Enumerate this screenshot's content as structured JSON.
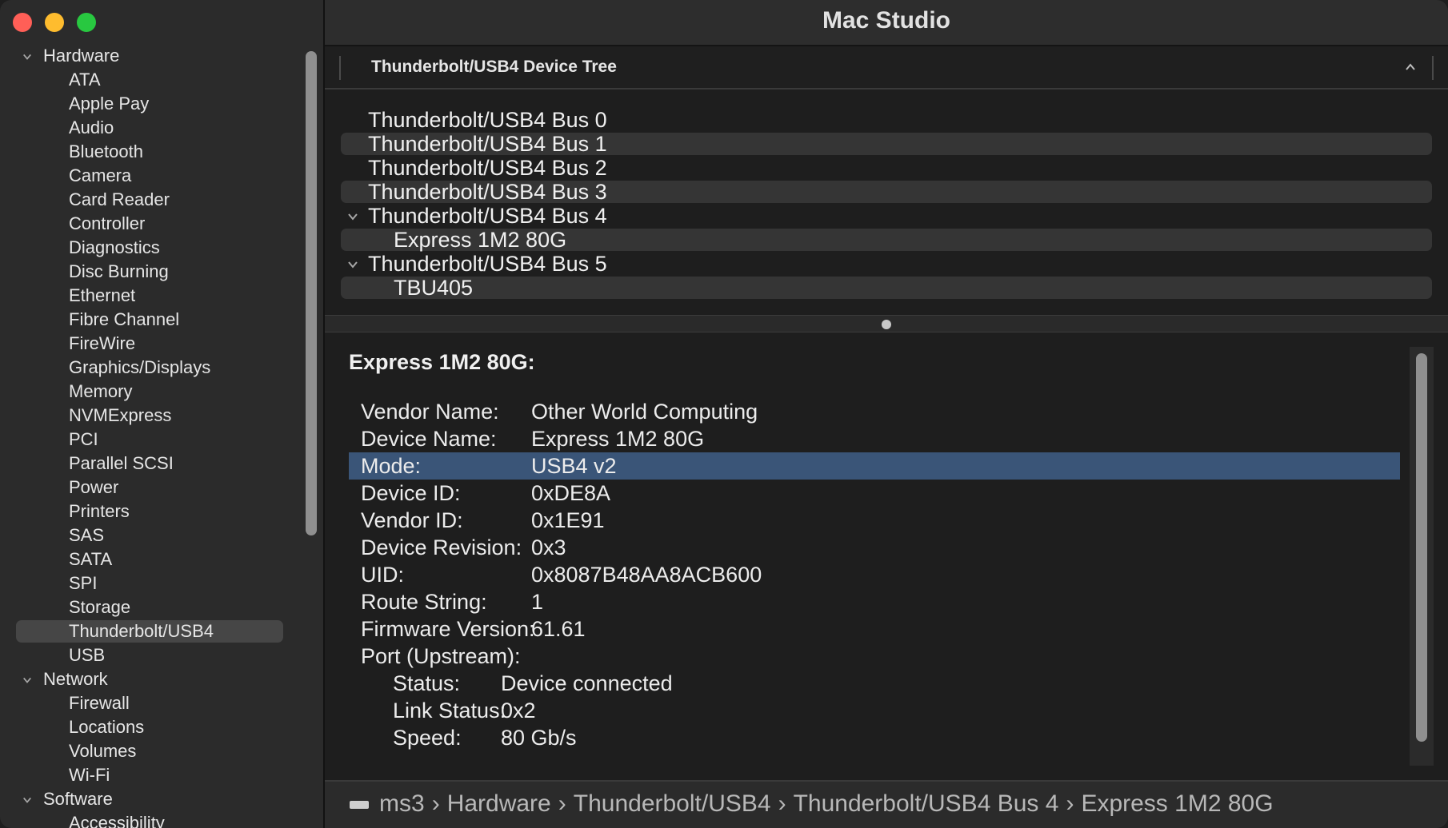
{
  "window": {
    "title": "Mac Studio"
  },
  "sidebar": {
    "groups": [
      {
        "label": "Hardware",
        "items": [
          "ATA",
          "Apple Pay",
          "Audio",
          "Bluetooth",
          "Camera",
          "Card Reader",
          "Controller",
          "Diagnostics",
          "Disc Burning",
          "Ethernet",
          "Fibre Channel",
          "FireWire",
          "Graphics/Displays",
          "Memory",
          "NVMExpress",
          "PCI",
          "Parallel SCSI",
          "Power",
          "Printers",
          "SAS",
          "SATA",
          "SPI",
          "Storage",
          "Thunderbolt/USB4",
          "USB"
        ]
      },
      {
        "label": "Network",
        "items": [
          "Firewall",
          "Locations",
          "Volumes",
          "Wi-Fi"
        ]
      },
      {
        "label": "Software",
        "items": [
          "Accessibility"
        ]
      }
    ],
    "selected": "Thunderbolt/USB4"
  },
  "tree": {
    "header": "Thunderbolt/USB4 Device Tree",
    "rows": [
      {
        "label": "Thunderbolt/USB4 Bus 0",
        "level": 0
      },
      {
        "label": "Thunderbolt/USB4 Bus 1",
        "level": 0
      },
      {
        "label": "Thunderbolt/USB4 Bus 2",
        "level": 0
      },
      {
        "label": "Thunderbolt/USB4 Bus 3",
        "level": 0
      },
      {
        "label": "Thunderbolt/USB4 Bus 4",
        "level": 0,
        "expanded": true
      },
      {
        "label": "Express 1M2 80G",
        "level": 1
      },
      {
        "label": "Thunderbolt/USB4 Bus 5",
        "level": 0,
        "expanded": true
      },
      {
        "label": "TBU405",
        "level": 1
      }
    ]
  },
  "detail": {
    "title": "Express 1M2 80G:",
    "properties": [
      {
        "key": "Vendor Name:",
        "value": "Other World Computing"
      },
      {
        "key": "Device Name:",
        "value": "Express 1M2 80G"
      },
      {
        "key": "Mode:",
        "value": "USB4 v2",
        "highlighted": true
      },
      {
        "key": "Device ID:",
        "value": "0xDE8A"
      },
      {
        "key": "Vendor ID:",
        "value": "0x1E91"
      },
      {
        "key": "Device Revision:",
        "value": "0x3"
      },
      {
        "key": "UID:",
        "value": "0x8087B48AA8ACB600"
      },
      {
        "key": "Route String:",
        "value": "1"
      },
      {
        "key": "Firmware Version:",
        "value": "61.61"
      },
      {
        "key": "Port (Upstream):",
        "value": ""
      }
    ],
    "sub_properties": [
      {
        "key": "Status:",
        "value": "Device connected"
      },
      {
        "key": "Link Status:",
        "value": "0x2"
      },
      {
        "key": "Speed:",
        "value": "80 Gb/s"
      }
    ]
  },
  "pathbar": {
    "crumbs": [
      "ms3",
      "Hardware",
      "Thunderbolt/USB4",
      "Thunderbolt/USB4 Bus 4",
      "Express 1M2 80G"
    ],
    "separator": "›"
  },
  "colors": {
    "highlight": "#3a5578",
    "sidebar_selected": "#464646",
    "close": "#ff5f57",
    "minimize": "#febc2e",
    "zoom": "#28c840"
  }
}
